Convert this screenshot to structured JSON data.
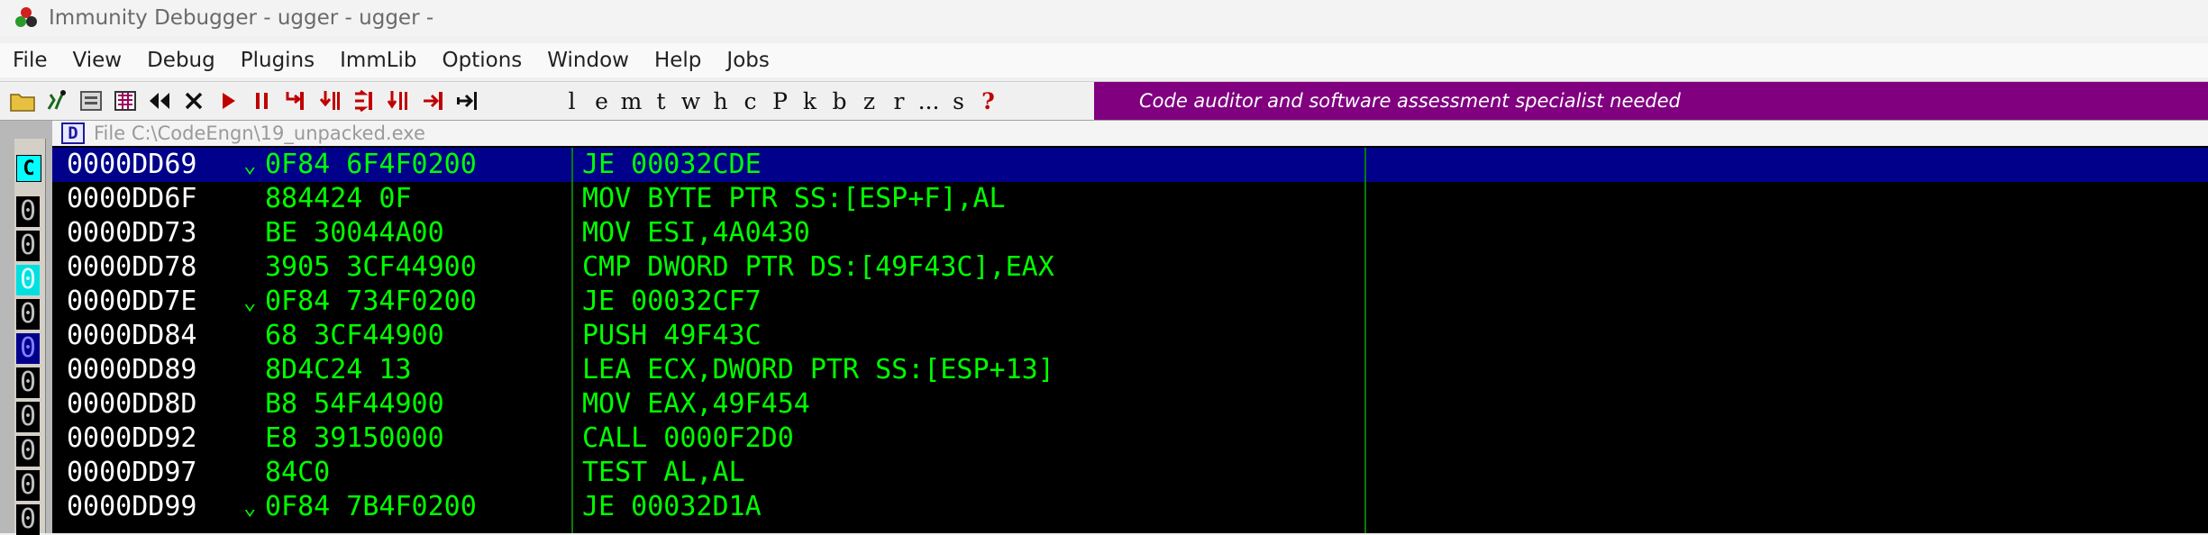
{
  "window": {
    "title": "Immunity Debugger - ugger - ugger -",
    "menu": [
      "File",
      "View",
      "Debug",
      "Plugins",
      "ImmLib",
      "Options",
      "Window",
      "Help",
      "Jobs"
    ]
  },
  "toolbar": {
    "icons": [
      "open-icon",
      "restart-icon",
      "close-file-icon",
      "memory-icon",
      "rewind-icon",
      "close-icon",
      "run-icon",
      "pause-icon",
      "step-into-icon",
      "step-over-icon",
      "trace-into-icon",
      "trace-over-icon",
      "execute-till-return-icon",
      "goto-icon"
    ],
    "letters": [
      "l",
      "e",
      "m",
      "t",
      "w",
      "h",
      "c",
      "P",
      "k",
      "b",
      "z",
      "r",
      "...",
      "s",
      "?"
    ],
    "banner": "Code auditor and software assessment specialist needed",
    "colors": {
      "banner_bg": "#800080",
      "run_red": "#c00000"
    }
  },
  "side_panel": {
    "letter": "C",
    "cells": [
      "0",
      "0",
      "0",
      "0",
      "0",
      "0",
      "0",
      "0",
      "0",
      "0"
    ]
  },
  "cpu_window": {
    "badge": "D",
    "title": "File C:\\CodeEngn\\19_unpacked.exe",
    "rows": [
      {
        "addr": "0000DD69",
        "jump": "⌄",
        "hex": "0F84 6F4F0200",
        "asm": "JE 00032CDE"
      },
      {
        "addr": "0000DD6F",
        "jump": "",
        "hex": "884424 0F",
        "asm": "MOV BYTE PTR SS:[ESP+F],AL"
      },
      {
        "addr": "0000DD73",
        "jump": "",
        "hex": "BE 30044A00",
        "asm": "MOV ESI,4A0430"
      },
      {
        "addr": "0000DD78",
        "jump": "",
        "hex": "3905 3CF44900",
        "asm": "CMP DWORD PTR DS:[49F43C],EAX"
      },
      {
        "addr": "0000DD7E",
        "jump": "⌄",
        "hex": "0F84 734F0200",
        "asm": "JE 00032CF7"
      },
      {
        "addr": "0000DD84",
        "jump": "",
        "hex": "68 3CF44900",
        "asm": "PUSH 49F43C"
      },
      {
        "addr": "0000DD89",
        "jump": "",
        "hex": "8D4C24 13",
        "asm": "LEA ECX,DWORD PTR SS:[ESP+13]"
      },
      {
        "addr": "0000DD8D",
        "jump": "",
        "hex": "B8 54F44900",
        "asm": "MOV EAX,49F454"
      },
      {
        "addr": "0000DD92",
        "jump": "",
        "hex": "E8 39150000",
        "asm": "CALL 0000F2D0"
      },
      {
        "addr": "0000DD97",
        "jump": "",
        "hex": "84C0",
        "asm": "TEST AL,AL"
      },
      {
        "addr": "0000DD99",
        "jump": "⌄",
        "hex": "0F84 7B4F0200",
        "asm": "JE 00032D1A"
      }
    ]
  }
}
